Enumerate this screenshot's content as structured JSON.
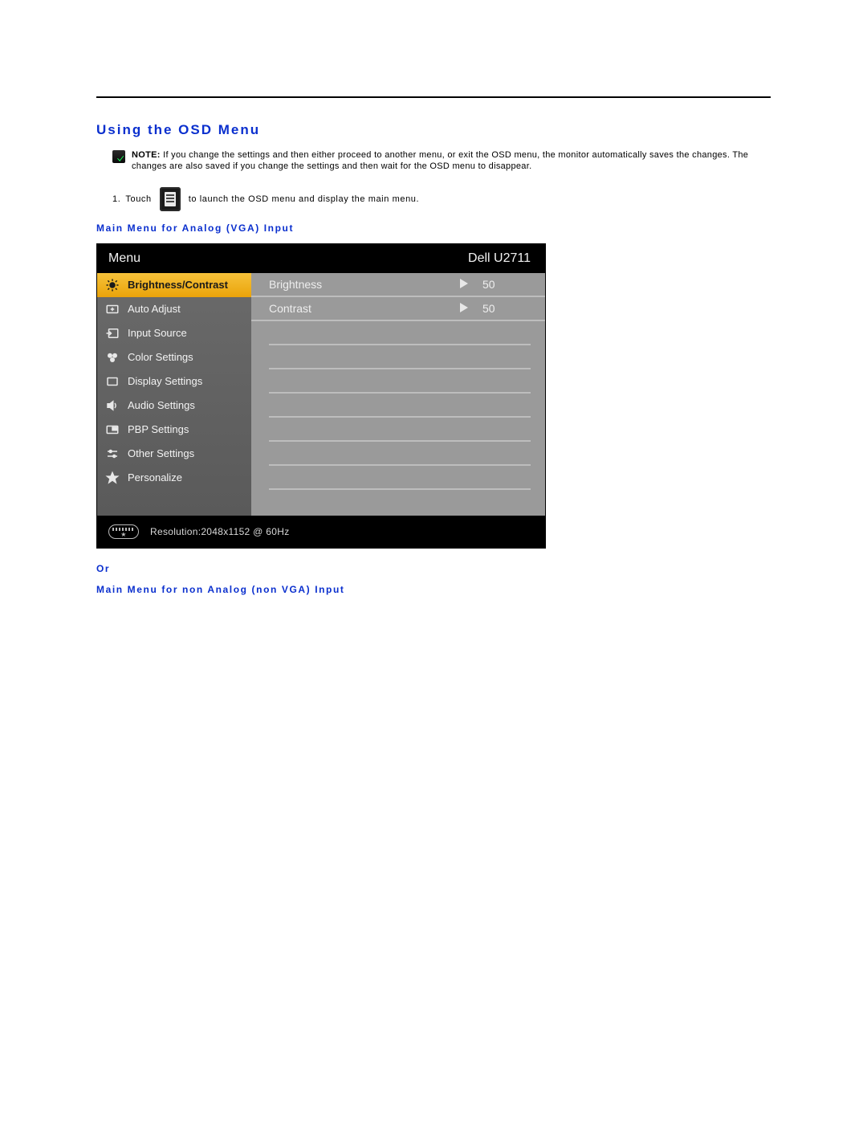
{
  "heading": "Using the OSD Menu",
  "note": {
    "label": "NOTE:",
    "text": "If you change the settings and then either proceed to another menu, or exit the OSD menu, the monitor automatically saves the changes. The changes are also saved if you change the settings and then wait for the OSD menu to disappear."
  },
  "step1": {
    "num": "1.",
    "before": "Touch",
    "after": "to launch the OSD menu and display the main menu."
  },
  "sub1": "Main Menu for Analog (VGA) Input",
  "or_label": "Or",
  "sub2": "Main Menu for non Analog (non VGA) Input",
  "osd": {
    "menu_label": "Menu",
    "model": "Dell U2711",
    "sidebar": [
      {
        "icon": "brightness",
        "label": "Brightness/Contrast",
        "selected": true
      },
      {
        "icon": "autoadjust",
        "label": "Auto Adjust",
        "selected": false
      },
      {
        "icon": "input",
        "label": "Input Source",
        "selected": false
      },
      {
        "icon": "color",
        "label": "Color Settings",
        "selected": false
      },
      {
        "icon": "display",
        "label": "Display Settings",
        "selected": false
      },
      {
        "icon": "audio",
        "label": "Audio Settings",
        "selected": false
      },
      {
        "icon": "pbp",
        "label": "PBP Settings",
        "selected": false
      },
      {
        "icon": "other",
        "label": "Other Settings",
        "selected": false
      },
      {
        "icon": "star",
        "label": "Personalize",
        "selected": false
      }
    ],
    "rows": [
      {
        "label": "Brightness",
        "value": "50"
      },
      {
        "label": "Contrast",
        "value": "50"
      }
    ],
    "status": "Resolution:2048x1152 @ 60Hz"
  }
}
